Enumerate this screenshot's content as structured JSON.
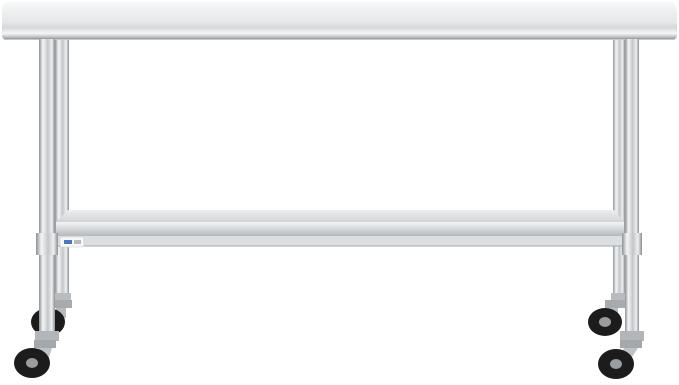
{
  "image": {
    "subject": "stainless-steel-work-table",
    "background_color": "#ffffff",
    "colors": {
      "steel_light": "#f2f3f4",
      "steel_mid": "#c9cccf",
      "steel_dark": "#8e9296",
      "wheel": "#1c1c1c",
      "hub": "#9a9da0"
    }
  }
}
